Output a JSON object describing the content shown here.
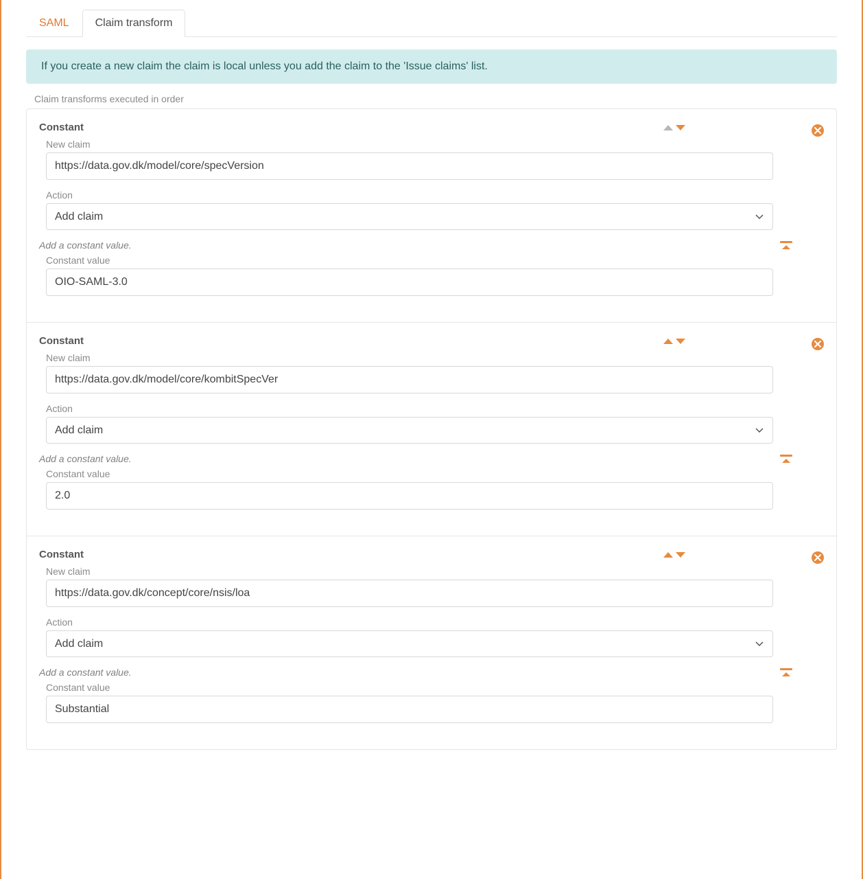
{
  "tabs": {
    "saml": "SAML",
    "claim_transform": "Claim transform"
  },
  "info_banner": "If you create a new claim the claim is local unless you add the claim to the 'Issue claims' list.",
  "section_hint": "Claim transforms executed in order",
  "labels": {
    "new_claim": "New claim",
    "action": "Action",
    "constant_value": "Constant value",
    "add_constant_note": "Add a constant value.",
    "action_option": "Add claim"
  },
  "transforms": [
    {
      "title": "Constant",
      "up_disabled": true,
      "new_claim": "https://data.gov.dk/model/core/specVersion",
      "action": "Add claim",
      "constant_value": "OIO-SAML-3.0"
    },
    {
      "title": "Constant",
      "up_disabled": false,
      "new_claim": "https://data.gov.dk/model/core/kombitSpecVer",
      "action": "Add claim",
      "constant_value": "2.0"
    },
    {
      "title": "Constant",
      "up_disabled": false,
      "new_claim": "https://data.gov.dk/concept/core/nsis/loa",
      "action": "Add claim",
      "constant_value": "Substantial"
    }
  ]
}
